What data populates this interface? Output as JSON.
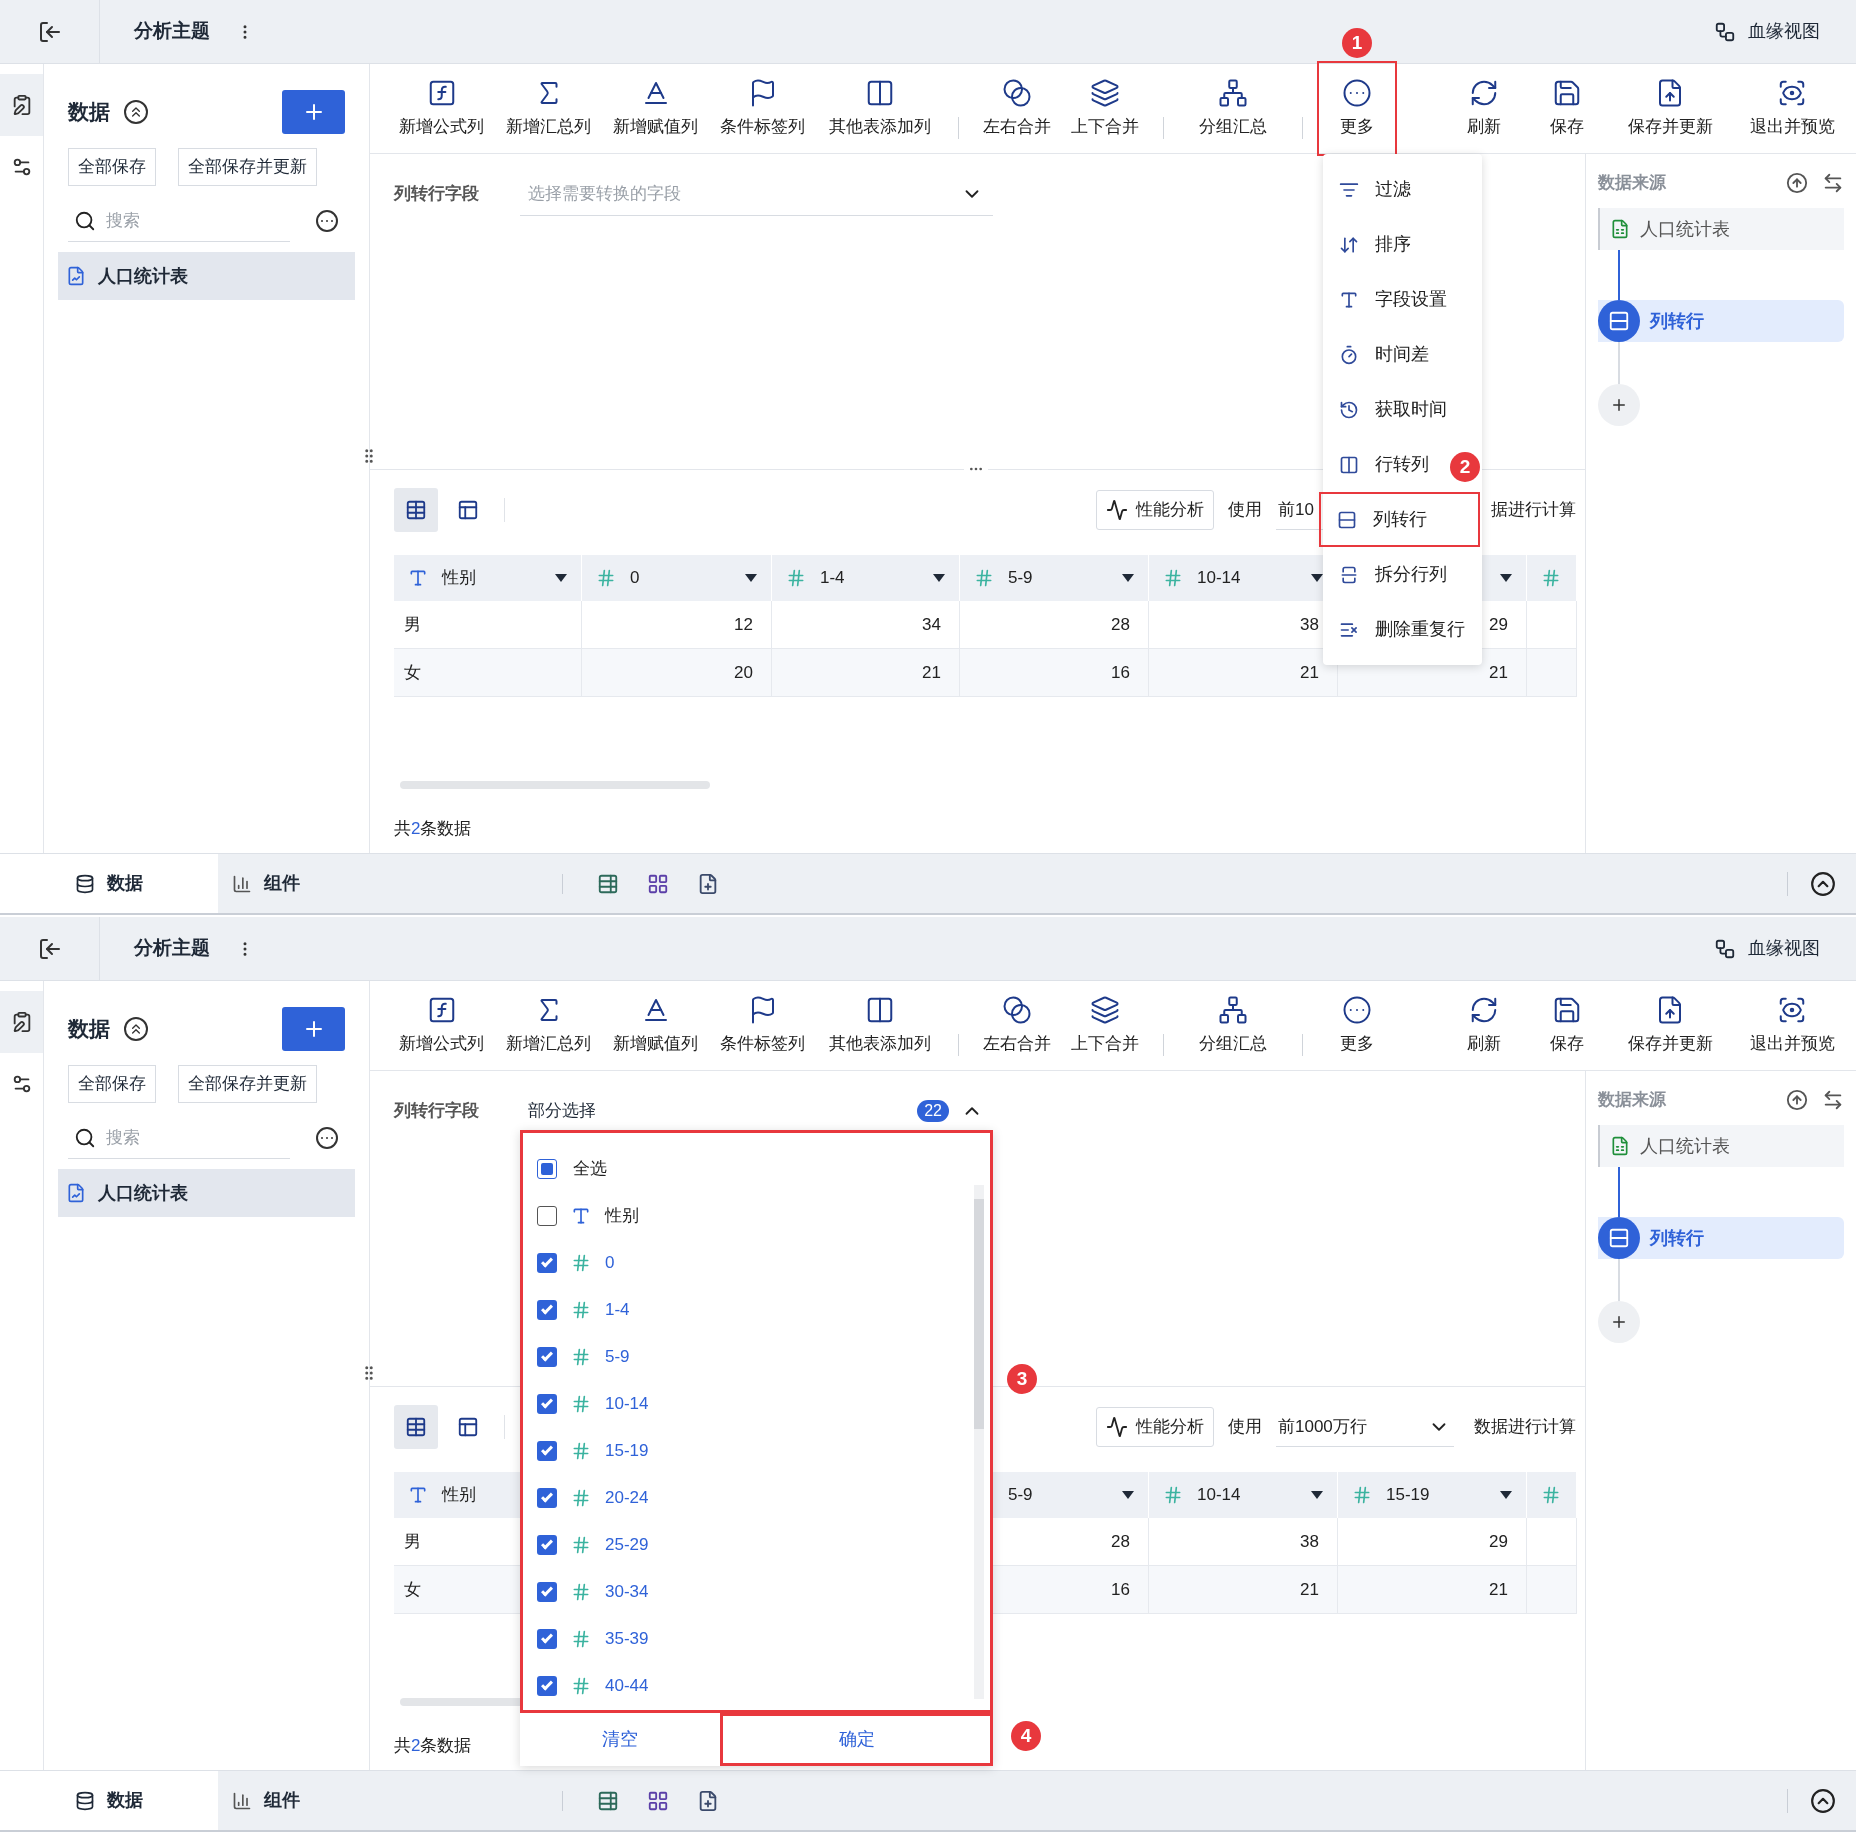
{
  "panels": [
    {
      "header": {
        "title": "分析主题",
        "lineage": "血缘视图"
      },
      "rail": [
        {
          "selected": true
        },
        {
          "selected": false
        }
      ],
      "sidebar": {
        "title": "数据",
        "buttons": [
          "全部保存",
          "全部保存并更新"
        ],
        "search_placeholder": "搜索",
        "tables": [
          {
            "label": "人口统计表",
            "selected": true
          }
        ]
      },
      "toolbar": {
        "groups": [
          [
            {
              "label": "新增公式列"
            },
            {
              "label": "新增汇总列"
            },
            {
              "label": "新增赋值列"
            },
            {
              "label": "条件标签列"
            },
            {
              "label": "其他表添加列"
            }
          ],
          [
            {
              "label": "左右合并"
            },
            {
              "label": "上下合并"
            }
          ],
          [
            {
              "label": "分组汇总"
            }
          ],
          [
            {
              "label": "更多",
              "boxed": true,
              "callout": "1"
            }
          ]
        ],
        "actions": [
          {
            "label": "刷新"
          },
          {
            "label": "保存"
          },
          {
            "label": "保存并更新"
          },
          {
            "label": "退出并预览"
          }
        ]
      },
      "field_row": {
        "label": "列转行字段",
        "placeholder": "选择需要转换的字段",
        "expanded": false
      },
      "table_toolbar": {
        "views": [
          {
            "selected": true
          },
          {
            "selected": false
          }
        ],
        "perf": "性能分析",
        "use": "使用",
        "limit": "前10",
        "limit_chevron": false,
        "suffix": "据进行计算"
      },
      "table": {
        "columns": [
          {
            "kind": "text",
            "name": "性别",
            "caret": true
          },
          {
            "kind": "number",
            "name": "0",
            "caret": true
          },
          {
            "kind": "number",
            "name": "1-4",
            "caret": true
          },
          {
            "kind": "number",
            "name": "5-9",
            "caret": true
          },
          {
            "kind": "number",
            "name": "10-14",
            "caret": true
          },
          {
            "caret": true
          },
          {
            "kind": "number"
          }
        ],
        "rows": [
          [
            "男",
            "12",
            "34",
            "28",
            "38",
            "29",
            null
          ],
          [
            "女",
            "20",
            "21",
            "16",
            "21",
            "21",
            null
          ]
        ]
      },
      "footer": {
        "prefix": "共",
        "count": "2",
        "suffix": "条数据"
      },
      "source": {
        "title": "数据来源",
        "table": "人口统计表",
        "steps": [
          {
            "label": "列转行",
            "selected": true
          }
        ]
      },
      "bottom_tabs": [
        {
          "label": "数据",
          "selected": true
        },
        {
          "label": "组件",
          "selected": false
        }
      ],
      "menu": {
        "items": [
          {
            "label": "过滤",
            "boxed": false
          },
          {
            "label": "排序",
            "boxed": false
          },
          {
            "label": "字段设置",
            "boxed": false
          },
          {
            "label": "时间差",
            "boxed": false
          },
          {
            "label": "获取时间",
            "boxed": false
          },
          {
            "label": "行转列",
            "boxed": false
          },
          {
            "label": "列转行",
            "boxed": true,
            "callout": "2"
          },
          {
            "label": "拆分行列",
            "boxed": false
          },
          {
            "label": "删除重复行",
            "boxed": false
          }
        ]
      }
    },
    {
      "header": {
        "title": "分析主题",
        "lineage": "血缘视图"
      },
      "rail": [
        {
          "selected": true
        },
        {
          "selected": false
        }
      ],
      "sidebar": {
        "title": "数据",
        "buttons": [
          "全部保存",
          "全部保存并更新"
        ],
        "search_placeholder": "搜索",
        "tables": [
          {
            "label": "人口统计表",
            "selected": true
          }
        ]
      },
      "toolbar": {
        "groups": [
          [
            {
              "label": "新增公式列"
            },
            {
              "label": "新增汇总列"
            },
            {
              "label": "新增赋值列"
            },
            {
              "label": "条件标签列"
            },
            {
              "label": "其他表添加列"
            }
          ],
          [
            {
              "label": "左右合并"
            },
            {
              "label": "上下合并"
            }
          ],
          [
            {
              "label": "分组汇总"
            }
          ],
          [
            {
              "label": "更多",
              "boxed": false
            }
          ]
        ],
        "actions": [
          {
            "label": "刷新"
          },
          {
            "label": "保存"
          },
          {
            "label": "保存并更新"
          },
          {
            "label": "退出并预览"
          }
        ]
      },
      "field_row": {
        "label": "列转行字段",
        "value": "部分选择",
        "count": "22",
        "expanded": true
      },
      "table_toolbar": {
        "views": [
          {
            "selected": true
          },
          {
            "selected": false
          }
        ],
        "perf": "性能分析",
        "use": "使用",
        "limit": "前1000万行",
        "limit_chevron": true,
        "suffix": "数据进行计算"
      },
      "table": {
        "columns": [
          {
            "kind": "text",
            "name": "性别"
          },
          {},
          {},
          {
            "name": "5-9",
            "caret": true
          },
          {
            "kind": "number",
            "name": "10-14",
            "caret": true
          },
          {
            "kind": "number",
            "name": "15-19",
            "caret": true
          },
          {
            "kind": "number"
          }
        ],
        "rows": [
          [
            "男",
            null,
            null,
            "28",
            "38",
            "29",
            null
          ],
          [
            "女",
            null,
            null,
            "16",
            "21",
            "21",
            null
          ]
        ]
      },
      "footer": {
        "prefix": "共",
        "count": "2",
        "suffix": "条数据"
      },
      "source": {
        "title": "数据来源",
        "table": "人口统计表",
        "steps": [
          {
            "label": "列转行",
            "selected": true
          }
        ]
      },
      "bottom_tabs": [
        {
          "label": "数据",
          "selected": true
        },
        {
          "label": "组件",
          "selected": false
        }
      ],
      "dropdown": {
        "boxed": true,
        "callout": "3",
        "select_all": {
          "label": "全选",
          "partial": true
        },
        "items": [
          {
            "kind": "text",
            "label": "性别",
            "checked": false
          },
          {
            "kind": "number",
            "label": "0",
            "checked": true
          },
          {
            "kind": "number",
            "label": "1-4",
            "checked": true
          },
          {
            "kind": "number",
            "label": "5-9",
            "checked": true
          },
          {
            "kind": "number",
            "label": "10-14",
            "checked": true
          },
          {
            "kind": "number",
            "label": "15-19",
            "checked": true
          },
          {
            "kind": "number",
            "label": "20-24",
            "checked": true
          },
          {
            "kind": "number",
            "label": "25-29",
            "checked": true
          },
          {
            "kind": "number",
            "label": "30-34",
            "checked": true
          },
          {
            "kind": "number",
            "label": "35-39",
            "checked": true
          },
          {
            "kind": "number",
            "label": "40-44",
            "checked": true
          }
        ],
        "clear": "清空",
        "confirm": {
          "label": "确定",
          "boxed": true,
          "callout": "4"
        }
      }
    }
  ]
}
